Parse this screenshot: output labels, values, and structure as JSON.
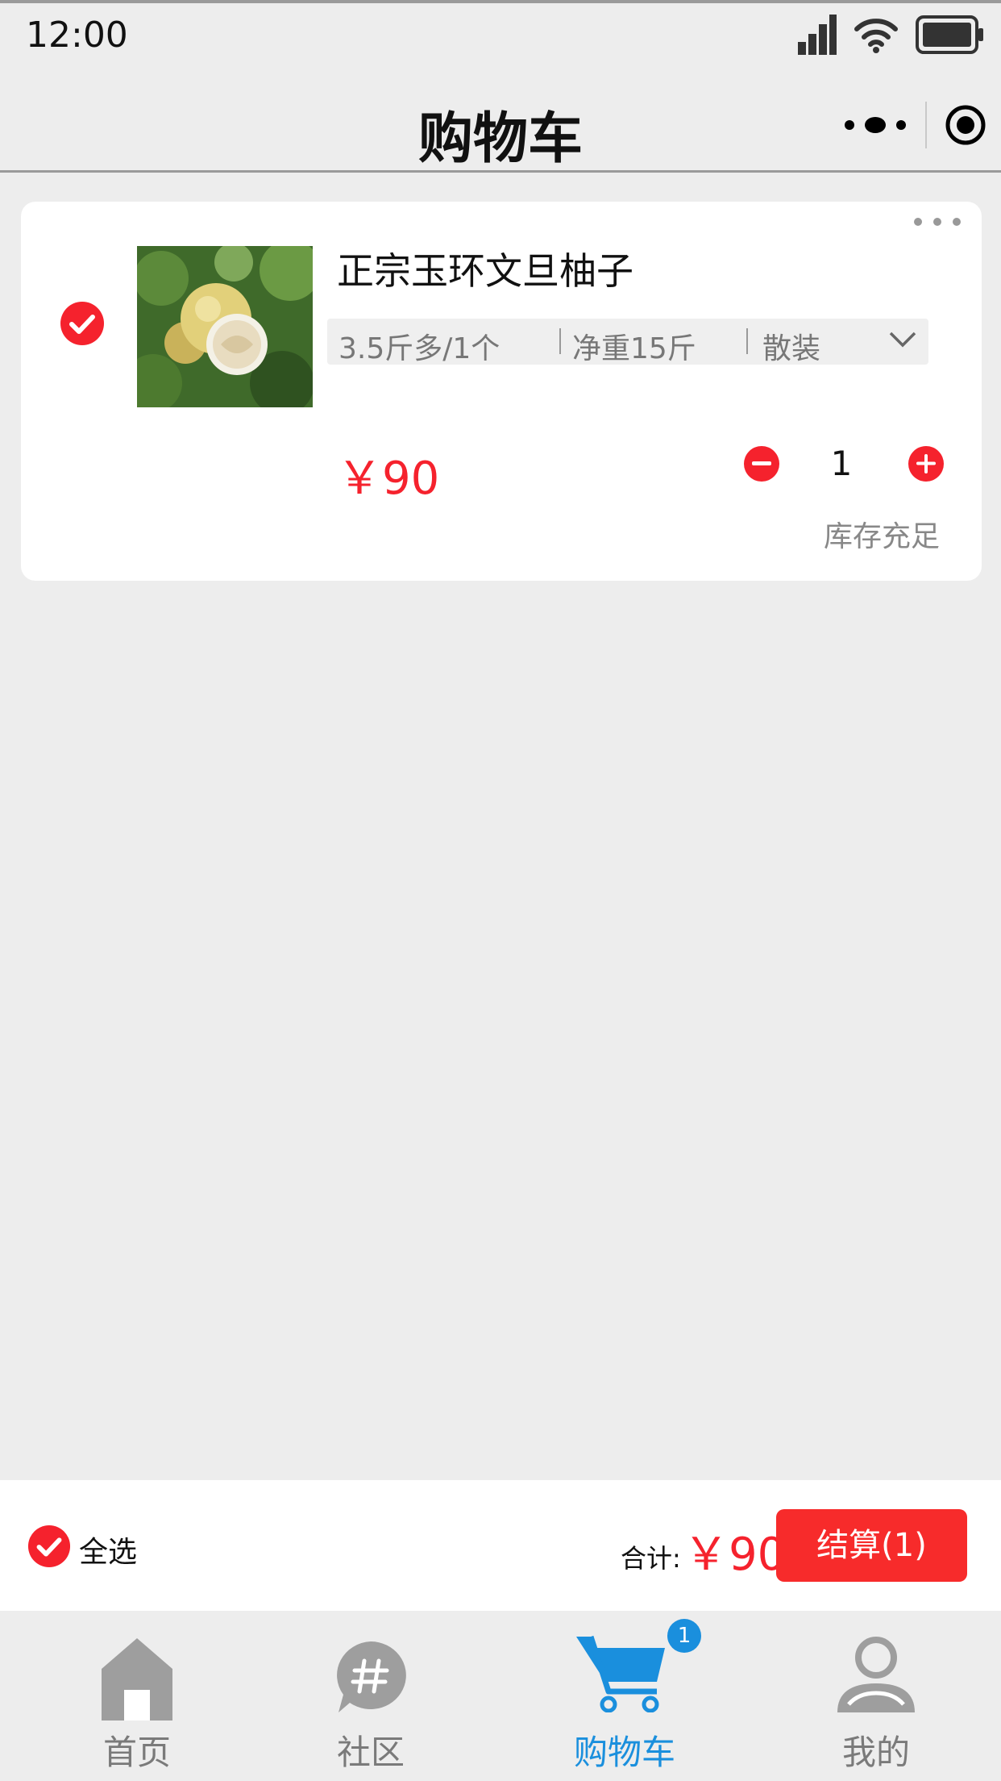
{
  "status_bar": {
    "time": "12:00"
  },
  "nav": {
    "title": "购物车"
  },
  "cart_item": {
    "title": "正宗玉环文旦柚子",
    "specs": [
      "3.5斤多/1个",
      "净重15斤",
      "散装"
    ],
    "price": "￥90",
    "quantity": "1",
    "stock": "库存充足",
    "selected": true
  },
  "checkout": {
    "select_all": "全选",
    "total_label": "合计:",
    "total_amount": "￥90",
    "settle_button": "结算(1)"
  },
  "tabs": [
    {
      "label": "首页",
      "icon": "home-icon"
    },
    {
      "label": "社区",
      "icon": "community-hash-icon"
    },
    {
      "label": "购物车",
      "icon": "cart-icon",
      "active": true,
      "badge": "1"
    },
    {
      "label": "我的",
      "icon": "user-icon"
    }
  ],
  "colors": {
    "accent_red": "#f5222d",
    "active_blue": "#1a8fdd",
    "background": "#ededed"
  }
}
